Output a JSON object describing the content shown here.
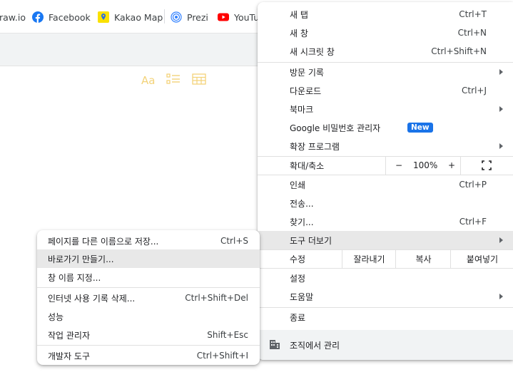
{
  "bookmarks": [
    {
      "label": "raw.io",
      "icon": "site-icon"
    },
    {
      "label": "Facebook",
      "icon": "facebook-icon",
      "color": "#1877f2"
    },
    {
      "label": "Kakao Map",
      "icon": "kakao-map-icon",
      "color": "#fae100"
    },
    {
      "label": "Prezi",
      "icon": "prezi-icon",
      "color": "#3181ff"
    },
    {
      "label": "YouTu",
      "icon": "youtube-icon",
      "color": "#ff0000"
    }
  ],
  "editor_tools": {
    "font": "Aa",
    "list": "list-icon",
    "table": "table-icon"
  },
  "menu": {
    "new_tab": {
      "label": "새 탭",
      "shortcut": "Ctrl+T"
    },
    "new_window": {
      "label": "새 창",
      "shortcut": "Ctrl+N"
    },
    "new_incognito": {
      "label": "새 시크릿 창",
      "shortcut": "Ctrl+Shift+N"
    },
    "history": {
      "label": "방문 기록"
    },
    "downloads": {
      "label": "다운로드",
      "shortcut": "Ctrl+J"
    },
    "bookmarks": {
      "label": "북마크"
    },
    "password_manager": {
      "label": "Google 비밀번호 관리자",
      "badge": "New"
    },
    "extensions": {
      "label": "확장 프로그램"
    },
    "zoom": {
      "label": "확대/축소",
      "minus": "−",
      "value": "100%",
      "plus": "+"
    },
    "print": {
      "label": "인쇄",
      "shortcut": "Ctrl+P"
    },
    "cast": {
      "label": "전송..."
    },
    "find": {
      "label": "찾기...",
      "shortcut": "Ctrl+F"
    },
    "more_tools": {
      "label": "도구 더보기"
    },
    "edit": {
      "label": "수정",
      "cut": "잘라내기",
      "copy": "복사",
      "paste": "붙여넣기"
    },
    "settings": {
      "label": "설정"
    },
    "help": {
      "label": "도움말"
    },
    "exit": {
      "label": "종료"
    },
    "managed": {
      "label": "조직에서 관리"
    }
  },
  "submenu": {
    "save_page": {
      "label": "페이지를 다른 이름으로 저장...",
      "shortcut": "Ctrl+S"
    },
    "create_shortcut": {
      "label": "바로가기 만들기..."
    },
    "name_window": {
      "label": "창 이름 지정..."
    },
    "clear_data": {
      "label": "인터넷 사용 기록 삭제...",
      "shortcut": "Ctrl+Shift+Del"
    },
    "performance": {
      "label": "성능"
    },
    "task_manager": {
      "label": "작업 관리자",
      "shortcut": "Shift+Esc"
    },
    "dev_tools": {
      "label": "개발자 도구",
      "shortcut": "Ctrl+Shift+I"
    }
  },
  "colors": {
    "highlight": "#e8e8e8",
    "badge": "#1a73e8"
  }
}
